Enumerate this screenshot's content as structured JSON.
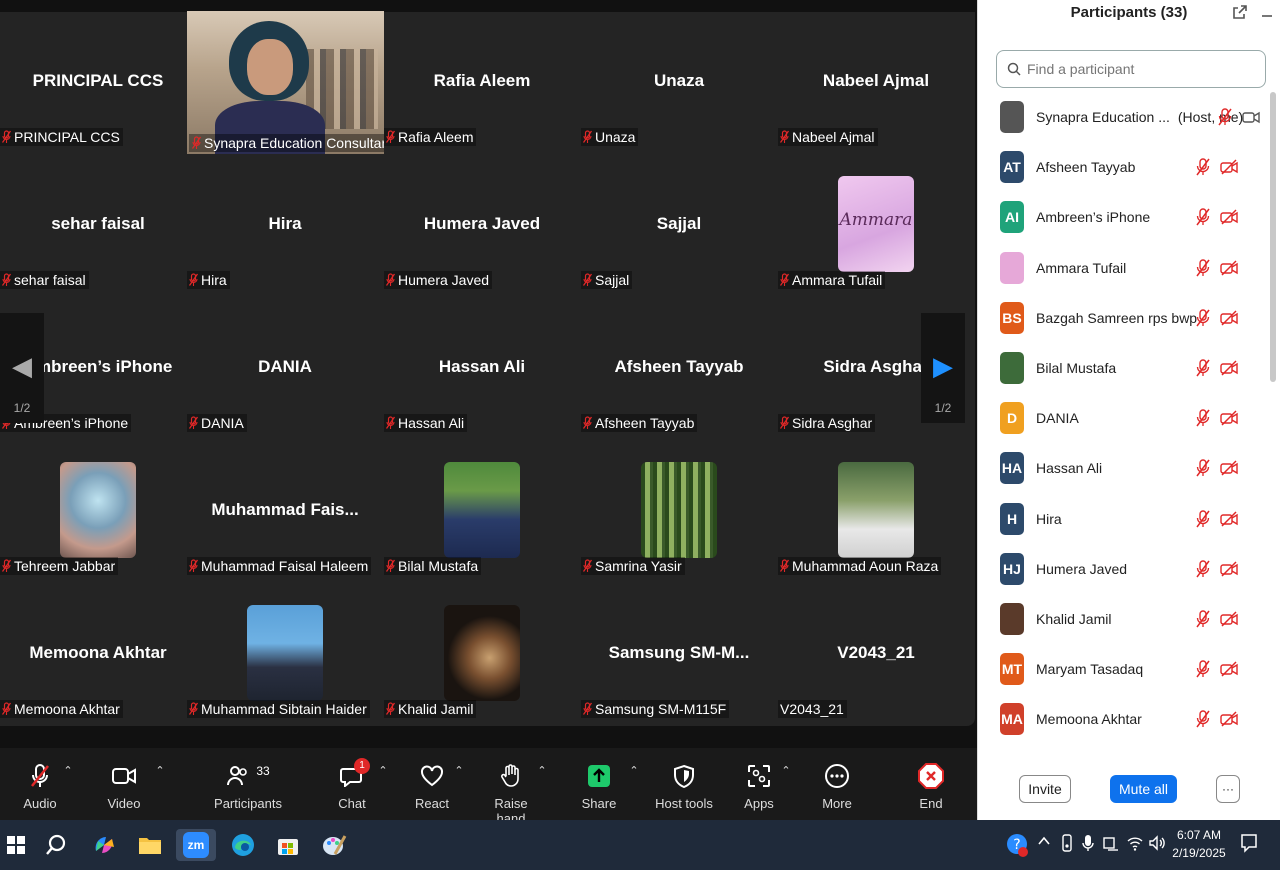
{
  "gallery": {
    "page_indicator": "1/2",
    "tiles": [
      {
        "big": "PRINCIPAL CCS",
        "tag": "PRINCIPAL CCS"
      },
      {
        "big": "",
        "tag": "Synapra Education Consultancy"
      },
      {
        "big": "Rafia Aleem",
        "tag": "Rafia Aleem"
      },
      {
        "big": "Unaza",
        "tag": "Unaza"
      },
      {
        "big": "Nabeel Ajmal",
        "tag": "Nabeel Ajmal"
      },
      {
        "big": "sehar faisal",
        "tag": "sehar faisal"
      },
      {
        "big": "Hira",
        "tag": "Hira"
      },
      {
        "big": "Humera Javed",
        "tag": "Humera Javed"
      },
      {
        "big": "Sajjal",
        "tag": "Sajjal"
      },
      {
        "big": "",
        "tag": "Ammara Tufail",
        "avatar_text": "Ammara"
      },
      {
        "big": "Ambreen’s iPhone",
        "tag": "Ambreen’s iPhone"
      },
      {
        "big": "DANIA",
        "tag": "DANIA"
      },
      {
        "big": "Hassan Ali",
        "tag": "Hassan Ali"
      },
      {
        "big": "Afsheen Tayyab",
        "tag": "Afsheen Tayyab"
      },
      {
        "big": "Sidra Asghar",
        "tag": "Sidra Asghar"
      },
      {
        "big": "",
        "tag": "Tehreem Jabbar"
      },
      {
        "big": "Muhammad  Fais...",
        "tag": "Muhammad Faisal Haleem"
      },
      {
        "big": "",
        "tag": "Bilal Mustafa"
      },
      {
        "big": "",
        "tag": "Samrina Yasir"
      },
      {
        "big": "",
        "tag": "Muhammad Aoun Raza"
      },
      {
        "big": "Memoona Akhtar",
        "tag": "Memoona Akhtar"
      },
      {
        "big": "",
        "tag": "Muhammad Sibtain Haider"
      },
      {
        "big": "",
        "tag": "Khalid Jamil"
      },
      {
        "big": "Samsung  SM-M...",
        "tag": "Samsung SM-M115F"
      },
      {
        "big": "V2043_21",
        "tag": "V2043_21"
      }
    ]
  },
  "toolbar": {
    "audio": "Audio",
    "video": "Video",
    "participants": "Participants",
    "participants_count": "33",
    "chat": "Chat",
    "chat_badge": "1",
    "react": "React",
    "raise_hand": "Raise hand",
    "share": "Share",
    "host_tools": "Host tools",
    "apps": "Apps",
    "more": "More",
    "end": "End"
  },
  "panel": {
    "title": "Participants (33)",
    "search_placeholder": "Find a participant",
    "invite": "Invite",
    "mute_all": "Mute all",
    "more": "···",
    "host_note": "(Host, me)",
    "participants": [
      {
        "initials": "",
        "name": "Synapra Education ...",
        "color": "#555555"
      },
      {
        "initials": "AT",
        "name": "Afsheen Tayyab",
        "color": "#2d4a6b"
      },
      {
        "initials": "AI",
        "name": "Ambreen’s iPhone",
        "color": "#1fa37a"
      },
      {
        "initials": "",
        "name": "Ammara Tufail",
        "color": "#e6a8d8"
      },
      {
        "initials": "BS",
        "name": "Bazgah Samreen rps bwp",
        "color": "#e05a1a"
      },
      {
        "initials": "",
        "name": "Bilal Mustafa",
        "color": "#3d6b3a"
      },
      {
        "initials": "D",
        "name": "DANIA",
        "color": "#f0a020"
      },
      {
        "initials": "HA",
        "name": "Hassan Ali",
        "color": "#2d4a6b"
      },
      {
        "initials": "H",
        "name": "Hira",
        "color": "#2d4a6b"
      },
      {
        "initials": "HJ",
        "name": "Humera Javed",
        "color": "#2d4a6b"
      },
      {
        "initials": "",
        "name": "Khalid Jamil",
        "color": "#5a3a2a"
      },
      {
        "initials": "MT",
        "name": "Maryam Tasadaq",
        "color": "#e05a1a"
      },
      {
        "initials": "MA",
        "name": "Memoona Akhtar",
        "color": "#d0402a"
      }
    ]
  },
  "taskbar": {
    "time": "6:07 AM",
    "date": "2/19/2025",
    "zoom_label": "zm"
  },
  "colors": {
    "accent": "#0e72ed",
    "muted_red": "#e02828",
    "end_red": "#e02828",
    "share_green": "#1ec96b"
  }
}
